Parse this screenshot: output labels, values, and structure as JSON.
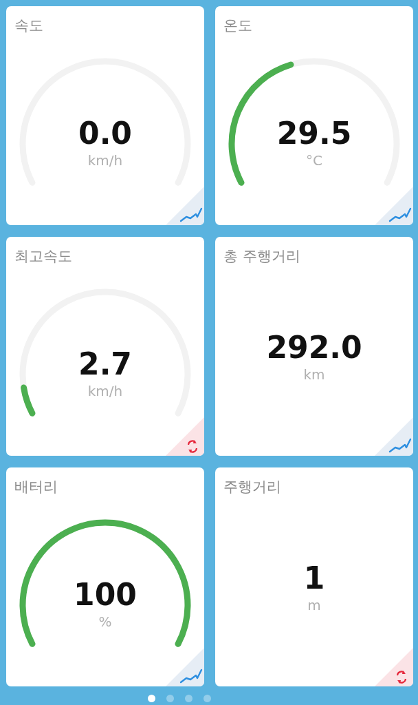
{
  "cards": [
    {
      "title": "속도",
      "kind": "gauge",
      "value": "0.0",
      "unit": "km/h",
      "corner": {
        "kind": "trend"
      }
    },
    {
      "title": "온도",
      "kind": "gauge",
      "value": "29.5",
      "unit": "°C",
      "corner": {
        "kind": "trend"
      }
    },
    {
      "title": "최고속도",
      "kind": "gauge",
      "value": "2.7",
      "unit": "km/h",
      "corner": {
        "kind": "refresh"
      }
    },
    {
      "title": "총 주행거리",
      "kind": "number",
      "value": "292.0",
      "unit": "km",
      "corner": {
        "kind": "trend"
      }
    },
    {
      "title": "배터리",
      "kind": "gauge",
      "value": "100",
      "unit": "%",
      "corner": {
        "kind": "trend"
      }
    },
    {
      "title": "주행거리",
      "kind": "number",
      "value": "1",
      "unit": "m",
      "corner": {
        "kind": "refresh"
      }
    }
  ],
  "pages": [
    {
      "selected": true
    },
    {
      "selected": false
    },
    {
      "selected": false
    },
    {
      "selected": false
    }
  ]
}
